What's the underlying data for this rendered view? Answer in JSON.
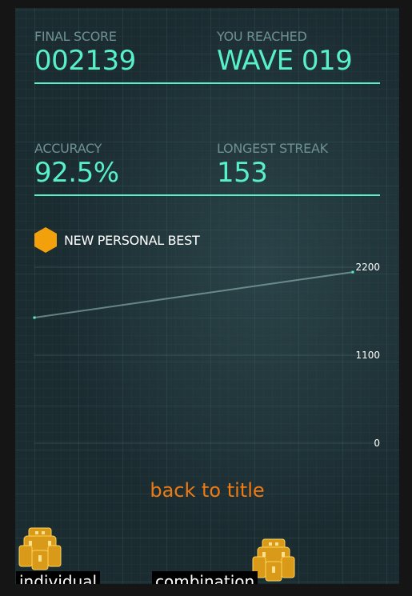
{
  "stats": {
    "final_score": {
      "label": "FINAL SCORE",
      "value": "002139"
    },
    "wave": {
      "label": "YOU REACHED",
      "value": "WAVE 019"
    },
    "accuracy": {
      "label": "ACCURACY",
      "value": "92.5%"
    },
    "streak": {
      "label": "LONGEST STREAK",
      "value": "153"
    }
  },
  "badge": {
    "label": "NEW PERSONAL BEST",
    "icon": "hexagon-icon",
    "color": "#f2a10c"
  },
  "chart_data": {
    "type": "line",
    "x": [
      1,
      2
    ],
    "series": [
      {
        "values": [
          1570,
          2139
        ]
      }
    ],
    "y_ticks": [
      "2200",
      "1100",
      "0"
    ],
    "ylim": [
      0,
      2200
    ],
    "grid": true
  },
  "back_button": {
    "label": "back to title"
  },
  "bottom_tabs": [
    {
      "label": "individual",
      "icon": "ship-icon"
    },
    {
      "label": "combination",
      "icon": "ship-icon"
    }
  ],
  "colors": {
    "accent": "#58f0c8",
    "label": "#6f9092",
    "orange": "#f07a12"
  }
}
